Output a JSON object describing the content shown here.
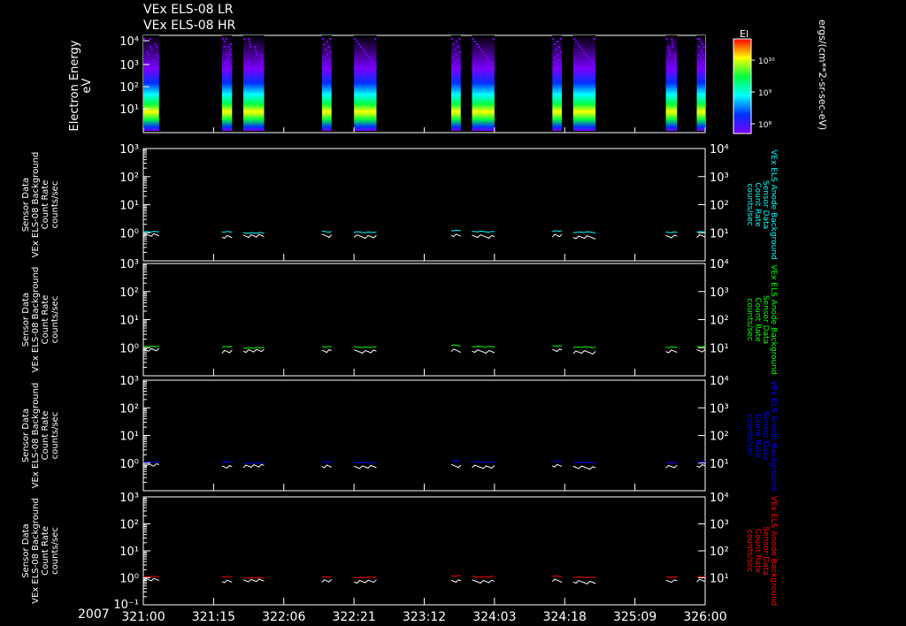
{
  "header": {
    "line1": "VEx ELS-08 LR",
    "line2": "VEx ELS-08 HR"
  },
  "spectrogram": {
    "ylabel1": "Electron Energy",
    "ylabel2": "eV",
    "yticks": [
      "10⁴",
      "10³",
      "10²",
      "10¹"
    ],
    "colorbar_title": "El",
    "colorbar_ticks": [
      "10¹⁰",
      "10⁹",
      "10⁸"
    ],
    "colorbar_units": "ergs/(cm**2-sr-sec-eV)",
    "colors": [
      "#7b00ff",
      "#0030ff",
      "#00ffff",
      "#00ff40",
      "#ffff00",
      "#ff0000"
    ]
  },
  "panels": [
    {
      "left_label": [
        "Sensor Data",
        "VEx ELS-08 Background",
        "Count Rate",
        "counts/sec"
      ],
      "right_label": [
        "VEx ELS Anode Background",
        "Sensor Data",
        "Count Rate",
        "counts/sec"
      ],
      "series_color": "#00ffff"
    },
    {
      "left_label": [
        "Sensor Data",
        "VEx ELS-08 Background",
        "Count Rate",
        "counts/sec"
      ],
      "right_label": [
        "VEx ELS Anode Background",
        "Sensor Data",
        "Count Rate",
        "counts/sec"
      ],
      "series_color": "#00ff00"
    },
    {
      "left_label": [
        "Sensor Data",
        "VEx ELS-08 Background",
        "Count Rate",
        "counts/sec"
      ],
      "right_label": [
        "VEx ELS Anode Background",
        "Sensor Data",
        "Count Rate",
        "counts/sec"
      ],
      "series_color": "#0000ff"
    },
    {
      "left_label": [
        "Sensor Data",
        "VEx ELS-08 Background",
        "Count Rate",
        "counts/sec"
      ],
      "right_label": [
        "VEx ELS Anode Background",
        "Sensor Data",
        "Count Rate",
        "counts/sec"
      ],
      "series_color": "#ff0000"
    }
  ],
  "chart_data": {
    "type": "line",
    "year": "2007",
    "x_tick_labels": [
      "321:00",
      "321:15",
      "322:06",
      "322:21",
      "323:12",
      "324:03",
      "324:18",
      "325:09",
      "326:00"
    ],
    "left_ytick_labels": [
      "10³",
      "10²",
      "10¹",
      "10⁰"
    ],
    "left_ytick_bottom": "10⁻¹",
    "right_ytick_labels": [
      "10⁴",
      "10³",
      "10²",
      "10¹"
    ],
    "left_ylim": [
      0.1,
      1000
    ],
    "right_ylim": [
      1,
      10000
    ],
    "xlim": [
      0,
      1
    ],
    "data_intervals": [
      [
        0.0,
        0.028
      ],
      [
        0.14,
        0.158
      ],
      [
        0.178,
        0.215
      ],
      [
        0.318,
        0.335
      ],
      [
        0.375,
        0.415
      ],
      [
        0.548,
        0.565
      ],
      [
        0.585,
        0.625
      ],
      [
        0.728,
        0.745
      ],
      [
        0.765,
        0.805
      ],
      [
        0.93,
        0.95
      ],
      [
        0.985,
        1.0
      ]
    ],
    "series": [
      {
        "name": "white",
        "color": "#ffffff",
        "values": [
          0.85,
          0.75,
          0.8,
          0.8,
          0.75,
          0.8,
          0.75,
          0.8,
          0.7,
          0.75,
          0.8
        ]
      },
      {
        "name": "colored",
        "values": [
          1.1,
          1.1,
          1.0,
          1.1,
          1.05,
          1.2,
          1.1,
          1.15,
          1.05,
          1.05,
          1.1
        ]
      }
    ]
  }
}
